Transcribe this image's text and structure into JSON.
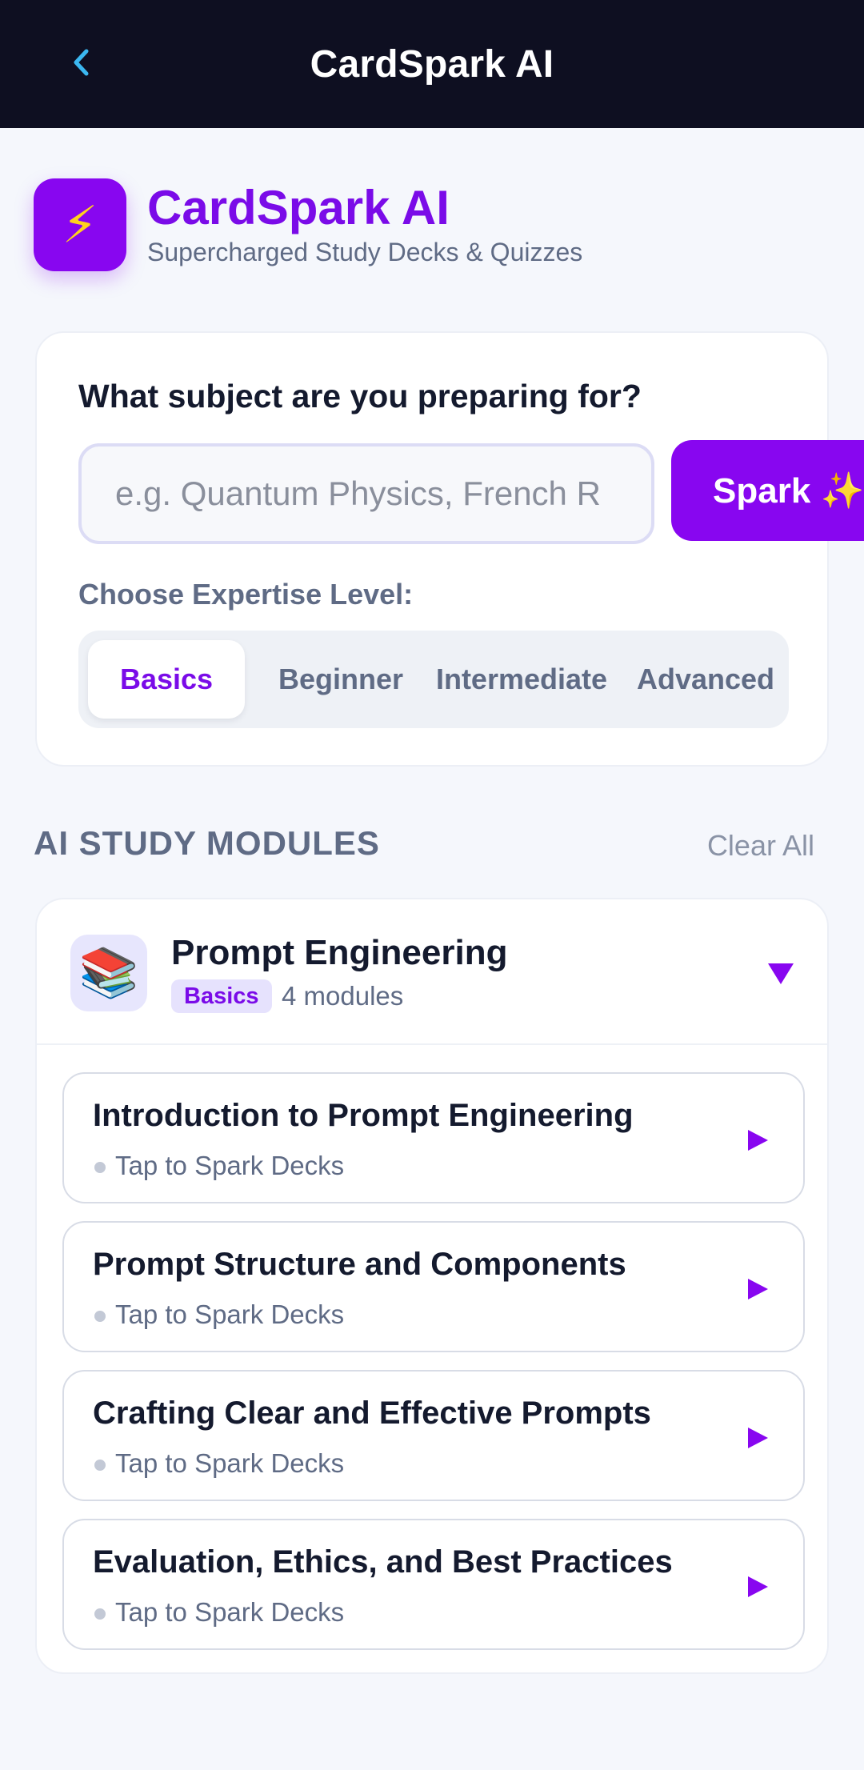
{
  "topbar": {
    "title": "CardSpark AI",
    "back_icon": "chevron-left-icon",
    "back_color": "#3bb7f0"
  },
  "brand": {
    "logo_icon": "lightning-bolt-icon",
    "logo_glyph": "⚡",
    "name": "CardSpark AI",
    "tagline": "Supercharged Study Decks & Quizzes",
    "accent": "#8806f0"
  },
  "subject": {
    "question": "What subject are you preparing for?",
    "input_value": "",
    "input_placeholder": "e.g. Quantum Physics, French R",
    "spark_label": "Spark ✨"
  },
  "expertise": {
    "label": "Choose Expertise Level:",
    "options": [
      "Basics",
      "Beginner",
      "Intermediate",
      "Advanced"
    ],
    "selected": "Basics"
  },
  "modules_section": {
    "heading": "AI STUDY MODULES",
    "clear_label": "Clear All"
  },
  "module": {
    "icon": "books-icon",
    "icon_glyph": "📚",
    "title": "Prompt Engineering",
    "level_badge": "Basics",
    "count": "4 modules",
    "caret_icon": "triangle-down-icon",
    "items": [
      {
        "title": "Introduction to Prompt Engineering",
        "subtitle": "Tap to Spark Decks"
      },
      {
        "title": "Prompt Structure and Components",
        "subtitle": "Tap to Spark Decks"
      },
      {
        "title": "Crafting Clear and Effective Prompts",
        "subtitle": "Tap to Spark Decks"
      },
      {
        "title": "Evaluation, Ethics, and Best Practices",
        "subtitle": "Tap to Spark Decks"
      }
    ]
  }
}
